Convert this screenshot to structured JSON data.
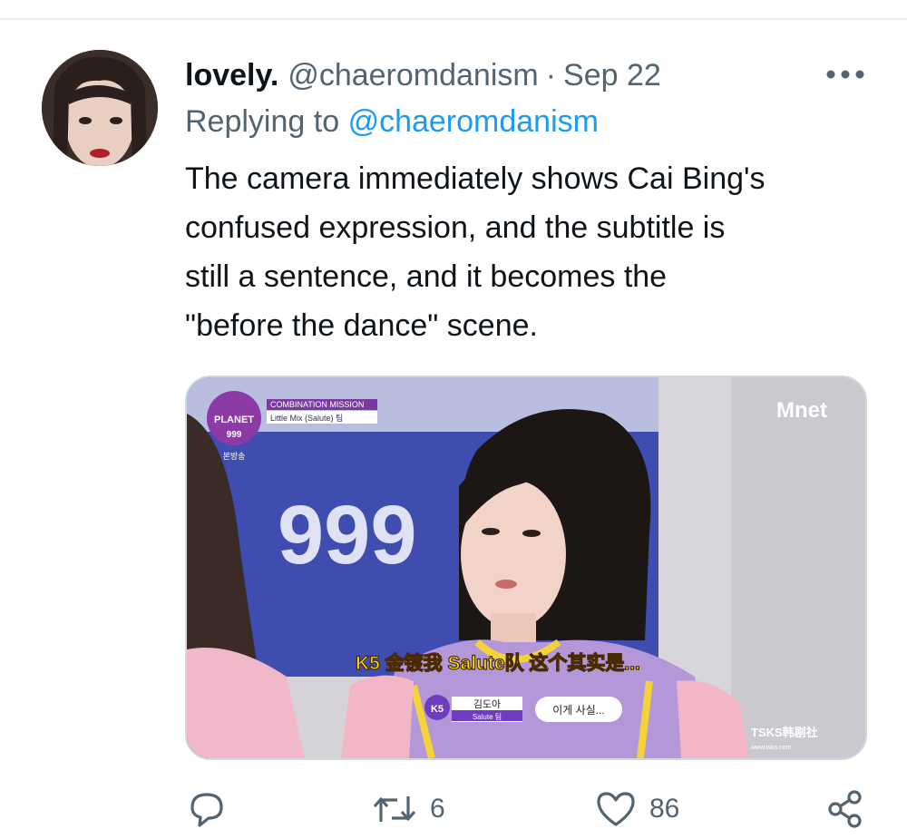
{
  "tweet": {
    "display_name": "lovely.",
    "handle": "@chaeromdanism",
    "separator": "·",
    "date": "Sep 22",
    "replying_prefix": "Replying to",
    "replying_to": "@chaeromdanism",
    "text_lines": [
      "The camera immediately shows Cai Bing's",
      "confused expression, and the subtitle is",
      "still a sentence, and it becomes the",
      "\"before the dance\" scene."
    ]
  },
  "media": {
    "show_logo_planet": "PLANET",
    "show_logo_number": "999",
    "show_logo_small": "본방송",
    "mission_title": "COMBINATION MISSION",
    "mission_subtitle": "Little Mix (Salute) 팀",
    "channel_logo": "Mnet",
    "backdrop_text": "999",
    "chinese_subtitle": "K5 金镀我 Salute队 这个其实是...",
    "name_tag_code": "K5",
    "name_tag_name": "김도아",
    "name_tag_team": "Salute 팀",
    "korean_subtitle": "이게 사실...",
    "watermark_main": "TSKS韩剧社",
    "watermark_url": "www.tsks.com"
  },
  "actions": {
    "reply_count": "",
    "retweet_count": "6",
    "like_count": "86"
  },
  "colors": {
    "text_primary": "#0f1419",
    "text_secondary": "#536471",
    "link": "#1d9bf0",
    "border": "#cfd9de"
  },
  "icons": [
    "avatar",
    "more-icon",
    "reply-icon",
    "retweet-icon",
    "like-icon",
    "share-icon"
  ]
}
